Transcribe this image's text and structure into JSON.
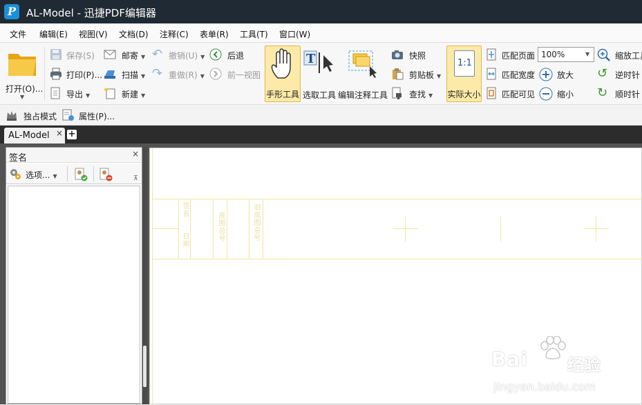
{
  "titlebar": {
    "title": "AL-Model - 迅捷PDF编辑器",
    "logo": "P"
  },
  "menu": [
    "文件",
    "编辑(E)",
    "视图(V)",
    "文档(D)",
    "注释(C)",
    "表单(R)",
    "工具(T)",
    "窗口(W)"
  ],
  "ribbon": {
    "open": "打开(O)...",
    "save": "保存(S)",
    "print": "打印(P)...",
    "export": "导出",
    "email": "邮寄",
    "scan": "扫描",
    "new": "新建",
    "undo": "撤销(U)",
    "redo": "重做(R)",
    "back": "后退",
    "prev_view": "前一视图",
    "hand_tool": "手形工具",
    "select_tool": "选取工具",
    "annot_tool": "编辑注释工具",
    "snapshot": "快照",
    "clipboard": "剪贴板",
    "find": "查找",
    "actual_size": "实际大小",
    "actual_size_icon": "1:1",
    "fit_page": "匹配页面",
    "fit_width": "匹配宽度",
    "fit_visible": "匹配可见",
    "zoom_value": "100%",
    "zoom_in": "放大",
    "zoom_out": "缩小",
    "zoom_tool": "缩放工具",
    "rotate_ccw": "逆时针",
    "rotate_cw": "顺时针"
  },
  "subtoolbar": {
    "exclusive_mode": "独占模式",
    "properties": "属性(P)..."
  },
  "tabs": {
    "doc_tab": "AL-Model",
    "close": "×",
    "add": "+"
  },
  "panel": {
    "title": "签名",
    "close": "×",
    "options": "选项...",
    "pin": "⊼"
  },
  "document": {
    "sign_label": "签名",
    "date_label": "日期",
    "drawing_no": "底图总号",
    "old_drawing_no": "旧底图总号"
  },
  "watermark": {
    "brand": "Bai",
    "brand2": "经验",
    "url": "jingyan.baidu.com"
  },
  "colors": {
    "titlebar": "#1f2a34",
    "active_tool": "#fde9a8",
    "page_lines": "#f0e7a0"
  }
}
